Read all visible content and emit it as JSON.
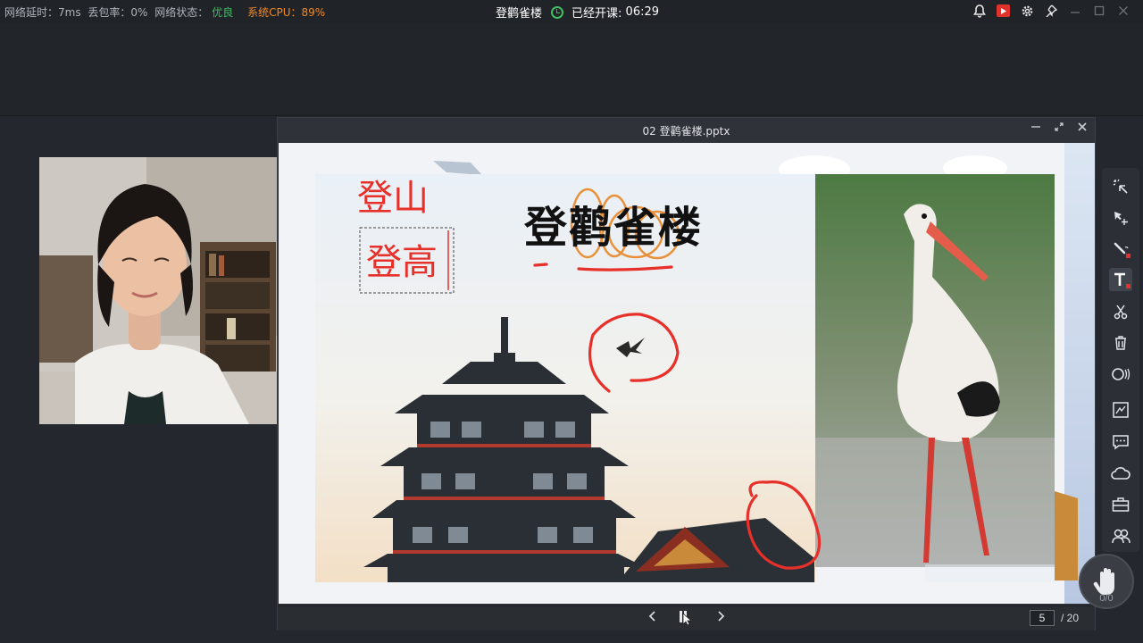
{
  "status": {
    "latency": "网络延时：7ms",
    "loss": "丢包率：0%",
    "network_label": "网络状态：",
    "network_value": "优良",
    "cpu": "系统CPU：89%"
  },
  "session": {
    "title": "登鹳雀楼",
    "elapsed_label": "已经开课:",
    "elapsed_time": "06:29"
  },
  "window": {
    "title": "02 登鹳雀楼.pptx"
  },
  "slide": {
    "title": "登鹳雀楼",
    "annotation_1": "登山",
    "annotation_2": "登高"
  },
  "pagination": {
    "current": "5",
    "total": "/ 20"
  },
  "hand_raise": {
    "count": "0/0"
  },
  "colors": {
    "good": "#3fbf62",
    "cpu_warn": "#f08a24",
    "annotation_red": "#e8302a",
    "annotation_orange": "#e8913a"
  },
  "icons": {
    "top_right": [
      "bell-icon",
      "record-icon",
      "gear-icon",
      "pin-icon",
      "minimize-icon",
      "maximize-icon",
      "close-icon"
    ],
    "toolbar": [
      "laser-pointer-icon",
      "select-move-icon",
      "pen-icon",
      "text-icon",
      "scissors-icon",
      "trash-icon",
      "shape-icon",
      "board-icon",
      "chat-icon",
      "cloud-icon",
      "toolbox-icon",
      "users-icon"
    ]
  }
}
